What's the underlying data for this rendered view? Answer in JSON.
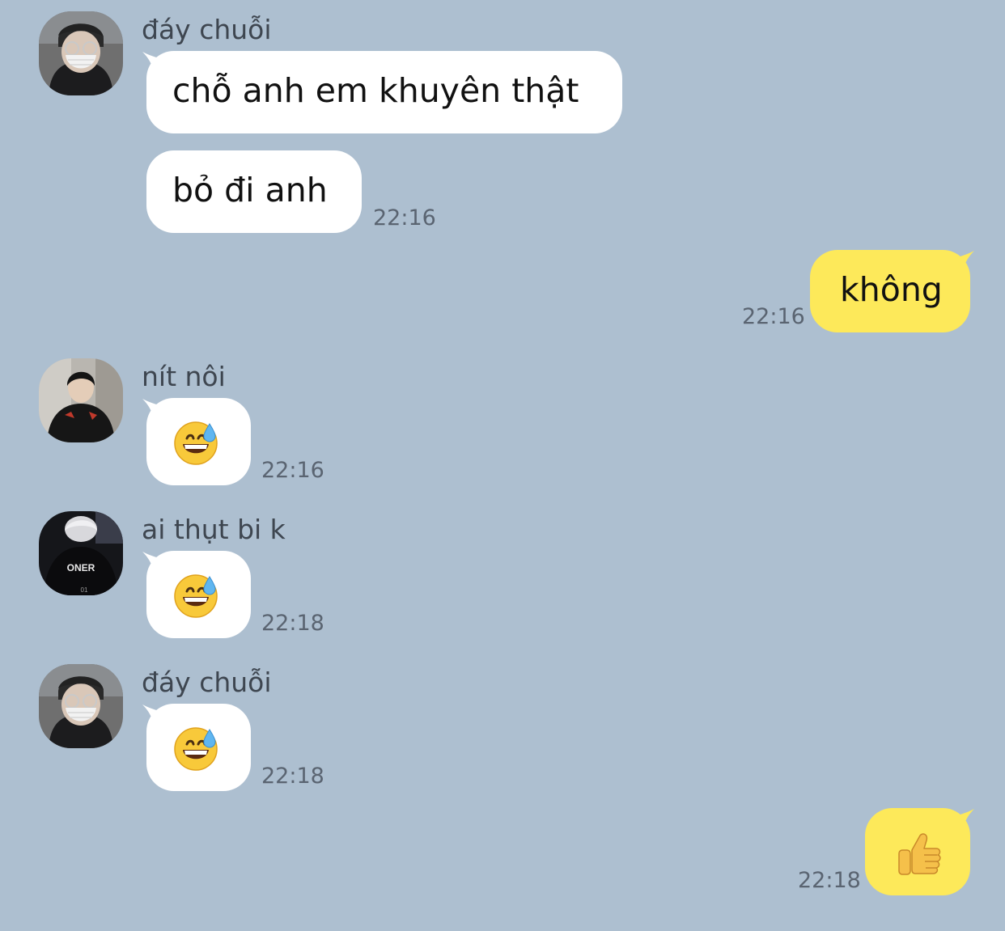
{
  "chat": {
    "background_color": "#adbfd0",
    "my_bubble_color": "#fde95a",
    "their_bubble_color": "#ffffff",
    "messages": [
      {
        "sender": "đáy chuỗi",
        "avatar": "avatar-masked-person",
        "texts": [
          "chỗ anh em khuyên thật",
          "bỏ đi anh"
        ],
        "time": "22:16"
      },
      {
        "sender": "me",
        "text": "không",
        "time": "22:16"
      },
      {
        "sender": "nít nôi",
        "avatar": "avatar-person-dark-jacket",
        "emoji": "grinning-face-with-sweat",
        "time": "22:16"
      },
      {
        "sender": "ai thụt bi k",
        "avatar": "avatar-oner-jacket",
        "avatar_text": "ONER",
        "emoji": "grinning-face-with-sweat",
        "time": "22:18"
      },
      {
        "sender": "đáy chuỗi",
        "avatar": "avatar-masked-person",
        "emoji": "grinning-face-with-sweat",
        "time": "22:18"
      },
      {
        "sender": "me",
        "emoji": "thumbs-up",
        "time": "22:18"
      }
    ]
  }
}
